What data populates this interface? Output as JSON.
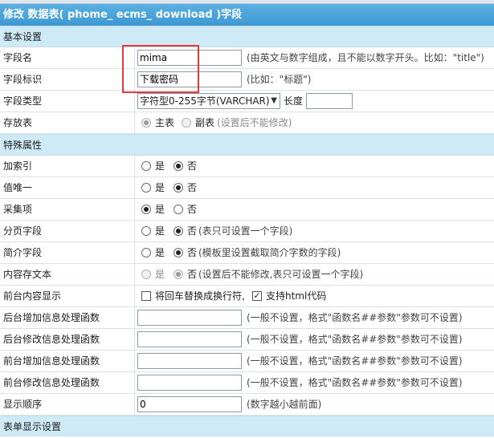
{
  "header": {
    "title": "修改 数据表( phome_ ecms_ download )字段"
  },
  "sections": {
    "basic": "基本设置",
    "special": "特殊属性",
    "form": "表单显示设置"
  },
  "fields": {
    "field_name": {
      "label": "字段名",
      "value": "mima",
      "note": "(由英文与数字组成，且不能以数字开头。比如：\"title\")"
    },
    "field_title": {
      "label": "字段标识",
      "value": "下载密码",
      "note": "(比如：\"标题\")"
    },
    "field_type": {
      "label": "字段类型",
      "selected": "字符型0-255字节(VARCHAR)",
      "length_label": "长度",
      "length_value": ""
    },
    "store_table": {
      "label": "存放表",
      "opt_main": "主表",
      "opt_sub": "副表",
      "note": "(设置后不能修改)"
    }
  },
  "special": {
    "index": {
      "label": "加索引",
      "yes": "是",
      "no": "否",
      "selected": "no"
    },
    "unique": {
      "label": "值唯一",
      "yes": "是",
      "no": "否",
      "selected": "no"
    },
    "collect": {
      "label": "采集项",
      "yes": "是",
      "no": "否",
      "selected": "yes"
    },
    "page_field": {
      "label": "分页字段",
      "yes": "是",
      "no": "否",
      "note": "(表只可设置一个字段)",
      "selected": "no"
    },
    "intro_field": {
      "label": "简介字段",
      "yes": "是",
      "no": "否",
      "note": "(模板里设置截取简介字数的字段)",
      "selected": "no"
    },
    "content_file": {
      "label": "内容存文本",
      "yes": "是",
      "no": "否",
      "note": "(设置后不能修改,表只可设置一个字段)",
      "selected": "no"
    },
    "front_display": {
      "label": "前台内容显示",
      "opt1": "将回车替换成换行符,",
      "opt2": "支持html代码",
      "opt1_checked": false,
      "opt2_checked": true
    },
    "back_add_func": {
      "label": "后台增加信息处理函数",
      "value": "",
      "note": "(一般不设置，格式\"函数名##参数\"参数可不设置)"
    },
    "back_edit_func": {
      "label": "后台修改信息处理函数",
      "value": "",
      "note": "(一般不设置，格式\"函数名##参数\"参数可不设置)"
    },
    "front_add_func": {
      "label": "前台增加信息处理函数",
      "value": "",
      "note": "(一般不设置，格式\"函数名##参数\"参数可不设置)"
    },
    "front_edit_func": {
      "label": "前台修改信息处理函数",
      "value": "",
      "note": "(一般不设置，格式\"函数名##参数\"参数可不设置)"
    },
    "order": {
      "label": "显示顺序",
      "value": "0",
      "note": "(数字越小越前面)"
    }
  },
  "colors": {
    "header_bg": "#4aa3da",
    "section_bg": "#cfeaf7",
    "highlight_box": "#e23a3a"
  }
}
